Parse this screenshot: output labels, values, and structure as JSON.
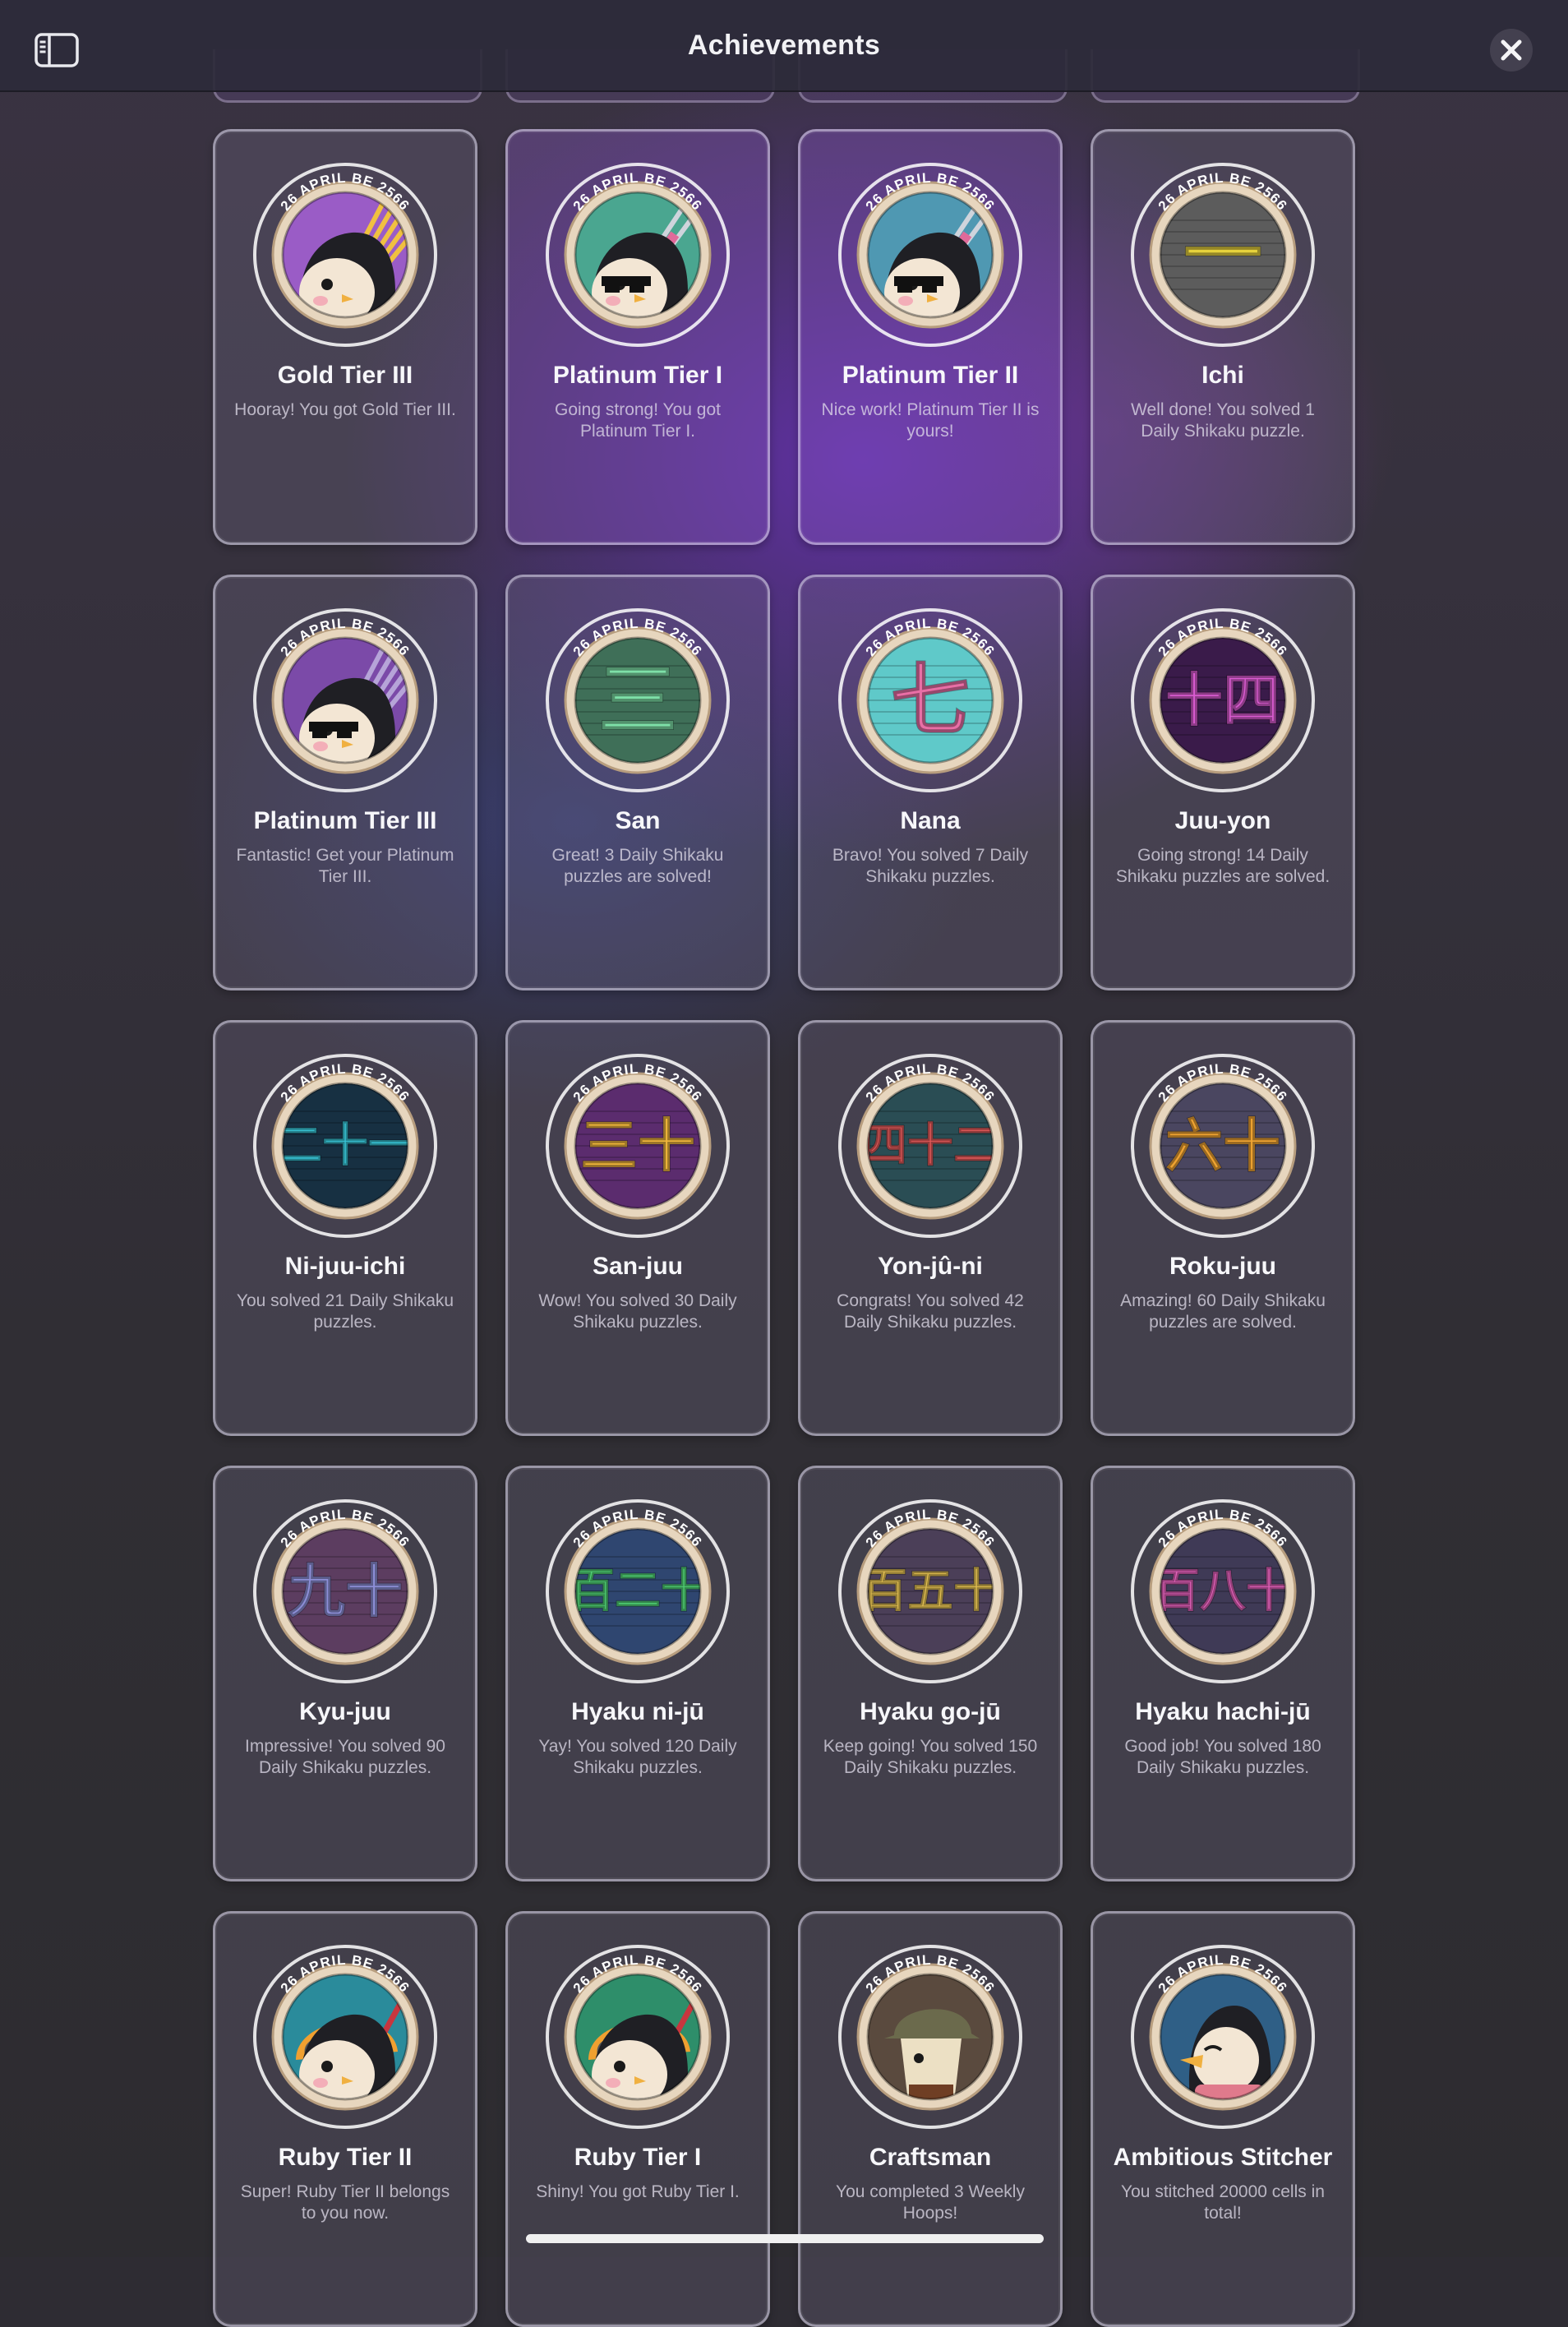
{
  "header": {
    "title": "Achievements",
    "left_icon": "sidebar-toggle-icon",
    "right_icon": "close-icon"
  },
  "badge_date": "26 APRIL BE 2566",
  "achievements": [
    {
      "name": "Gold Tier III",
      "desc": "Hooray! You got Gold Tier III.",
      "inner": "#9a5cc6",
      "glyph": "",
      "glyph_color": "",
      "art": "penguin-claws-gold",
      "card": "normal"
    },
    {
      "name": "Platinum Tier I",
      "desc": "Going strong! You got Platinum Tier I.",
      "inner": "#4aa690",
      "glyph": "",
      "glyph_color": "",
      "art": "penguin-needles",
      "card": "purple"
    },
    {
      "name": "Platinum Tier II",
      "desc": "Nice work! Platinum Tier II is yours!",
      "inner": "#4f98b2",
      "glyph": "",
      "glyph_color": "",
      "art": "penguin-needles",
      "card": "purple"
    },
    {
      "name": "Ichi",
      "desc": "Well done! You solved 1 Daily Shikaku puzzle.",
      "inner": "#5c5c5c",
      "glyph": "一",
      "glyph_color": "#e7d23c",
      "art": "glyph",
      "card": "normal"
    },
    {
      "name": "Platinum Tier III",
      "desc": "Fantastic! Get your Platinum Tier III.",
      "inner": "#7b4aa8",
      "glyph": "",
      "glyph_color": "",
      "art": "penguin-claws-purple",
      "card": "normal"
    },
    {
      "name": "San",
      "desc": "Great! 3 Daily Shikaku puzzles are solved!",
      "inner": "#3f6f58",
      "glyph": "三",
      "glyph_color": "#7ee0a8",
      "art": "glyph",
      "card": "normal"
    },
    {
      "name": "Nana",
      "desc": "Bravo! You solved 7 Daily Shikaku puzzles.",
      "inner": "#5fc9c9",
      "glyph": "七",
      "glyph_color": "#e96fa6",
      "art": "glyph",
      "card": "normal"
    },
    {
      "name": "Juu-yon",
      "desc": "Going strong! 14 Daily Shikaku puzzles are solved.",
      "inner": "#3a1b4a",
      "glyph": "十四",
      "glyph_color": "#d95bd0",
      "art": "glyph",
      "card": "normal"
    },
    {
      "name": "Ni-juu-ichi",
      "desc": "You solved 21 Daily Shikaku puzzles.",
      "inner": "#173042",
      "glyph": "二十一",
      "glyph_color": "#38c6d8",
      "art": "glyph",
      "card": "normal"
    },
    {
      "name": "San-juu",
      "desc": "Wow! You solved 30 Daily Shikaku puzzles.",
      "inner": "#5b2c6e",
      "glyph": "三十",
      "glyph_color": "#f0b63c",
      "art": "glyph",
      "card": "normal"
    },
    {
      "name": "Yon-jû-ni",
      "desc": "Congrats! You solved 42 Daily Shikaku puzzles.",
      "inner": "#2a4d54",
      "glyph": "四十二",
      "glyph_color": "#e25a5a",
      "art": "glyph",
      "card": "normal"
    },
    {
      "name": "Roku-juu",
      "desc": "Amazing! 60 Daily Shikaku puzzles are solved.",
      "inner": "#4a4660",
      "glyph": "六十",
      "glyph_color": "#f0a432",
      "art": "glyph",
      "card": "normal"
    },
    {
      "name": "Kyu-juu",
      "desc": "Impressive! You solved 90 Daily Shikaku puzzles.",
      "inner": "#5c3d60",
      "glyph": "九十",
      "glyph_color": "#8d8fd8",
      "art": "glyph",
      "card": "normal"
    },
    {
      "name": "Hyaku ni-jū",
      "desc": "Yay! You solved 120 Daily Shikaku puzzles.",
      "inner": "#2f4670",
      "glyph": "百二十",
      "glyph_color": "#4fcf74",
      "art": "glyph",
      "card": "normal"
    },
    {
      "name": "Hyaku go-jū",
      "desc": "Keep going! You solved 150 Daily Shikaku puzzles.",
      "inner": "#4b3f58",
      "glyph": "百五十",
      "glyph_color": "#e3c052",
      "art": "glyph",
      "card": "normal"
    },
    {
      "name": "Hyaku hachi-jū",
      "desc": "Good job! You solved 180 Daily Shikaku puzzles.",
      "inner": "#3f3a56",
      "glyph": "百八十",
      "glyph_color": "#e060b8",
      "art": "glyph",
      "card": "normal"
    },
    {
      "name": "Ruby Tier II",
      "desc": "Super! Ruby Tier II belongs to you now.",
      "inner": "#2a8b9b",
      "glyph": "",
      "glyph_color": "",
      "art": "penguin-helmet",
      "card": "normal"
    },
    {
      "name": "Ruby Tier I",
      "desc": "Shiny! You got Ruby Tier I.",
      "inner": "#2e8e6a",
      "glyph": "",
      "glyph_color": "",
      "art": "penguin-helmet",
      "card": "normal"
    },
    {
      "name": "Craftsman",
      "desc": "You completed 3 Weekly Hoops!",
      "inner": "#5a4a3e",
      "glyph": "",
      "glyph_color": "",
      "art": "craftsman",
      "card": "normal"
    },
    {
      "name": "Ambitious Stitcher",
      "desc": "You stitched 20000 cells in total!",
      "inner": "#2f5f86",
      "glyph": "",
      "glyph_color": "",
      "art": "penguin-scarf",
      "card": "normal"
    }
  ]
}
